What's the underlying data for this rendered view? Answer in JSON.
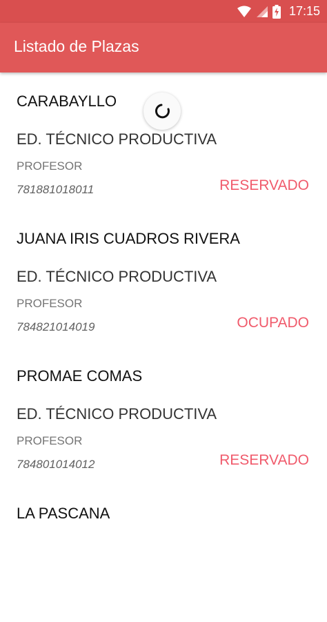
{
  "status_bar": {
    "time": "17:15",
    "icons": [
      "wifi-icon",
      "signal-icon",
      "battery-charging-icon"
    ]
  },
  "app_bar": {
    "title": "Listado de Plazas"
  },
  "colors": {
    "status_bar": "#d94f4f",
    "app_bar": "#e05858",
    "status_text": "#f05a6b"
  },
  "items": [
    {
      "name": "CARABAYLLO",
      "level": "ED. TÉCNICO PRODUCTIVA",
      "role": "PROFESOR",
      "code": "781881018011",
      "status": "RESERVADO"
    },
    {
      "name": "JUANA IRIS CUADROS RIVERA",
      "level": "ED. TÉCNICO PRODUCTIVA",
      "role": "PROFESOR",
      "code": "784821014019",
      "status": "OCUPADO"
    },
    {
      "name": "PROMAE COMAS",
      "level": "ED. TÉCNICO PRODUCTIVA",
      "role": "PROFESOR",
      "code": "784801014012",
      "status": "RESERVADO"
    },
    {
      "name": "LA PASCANA"
    }
  ]
}
